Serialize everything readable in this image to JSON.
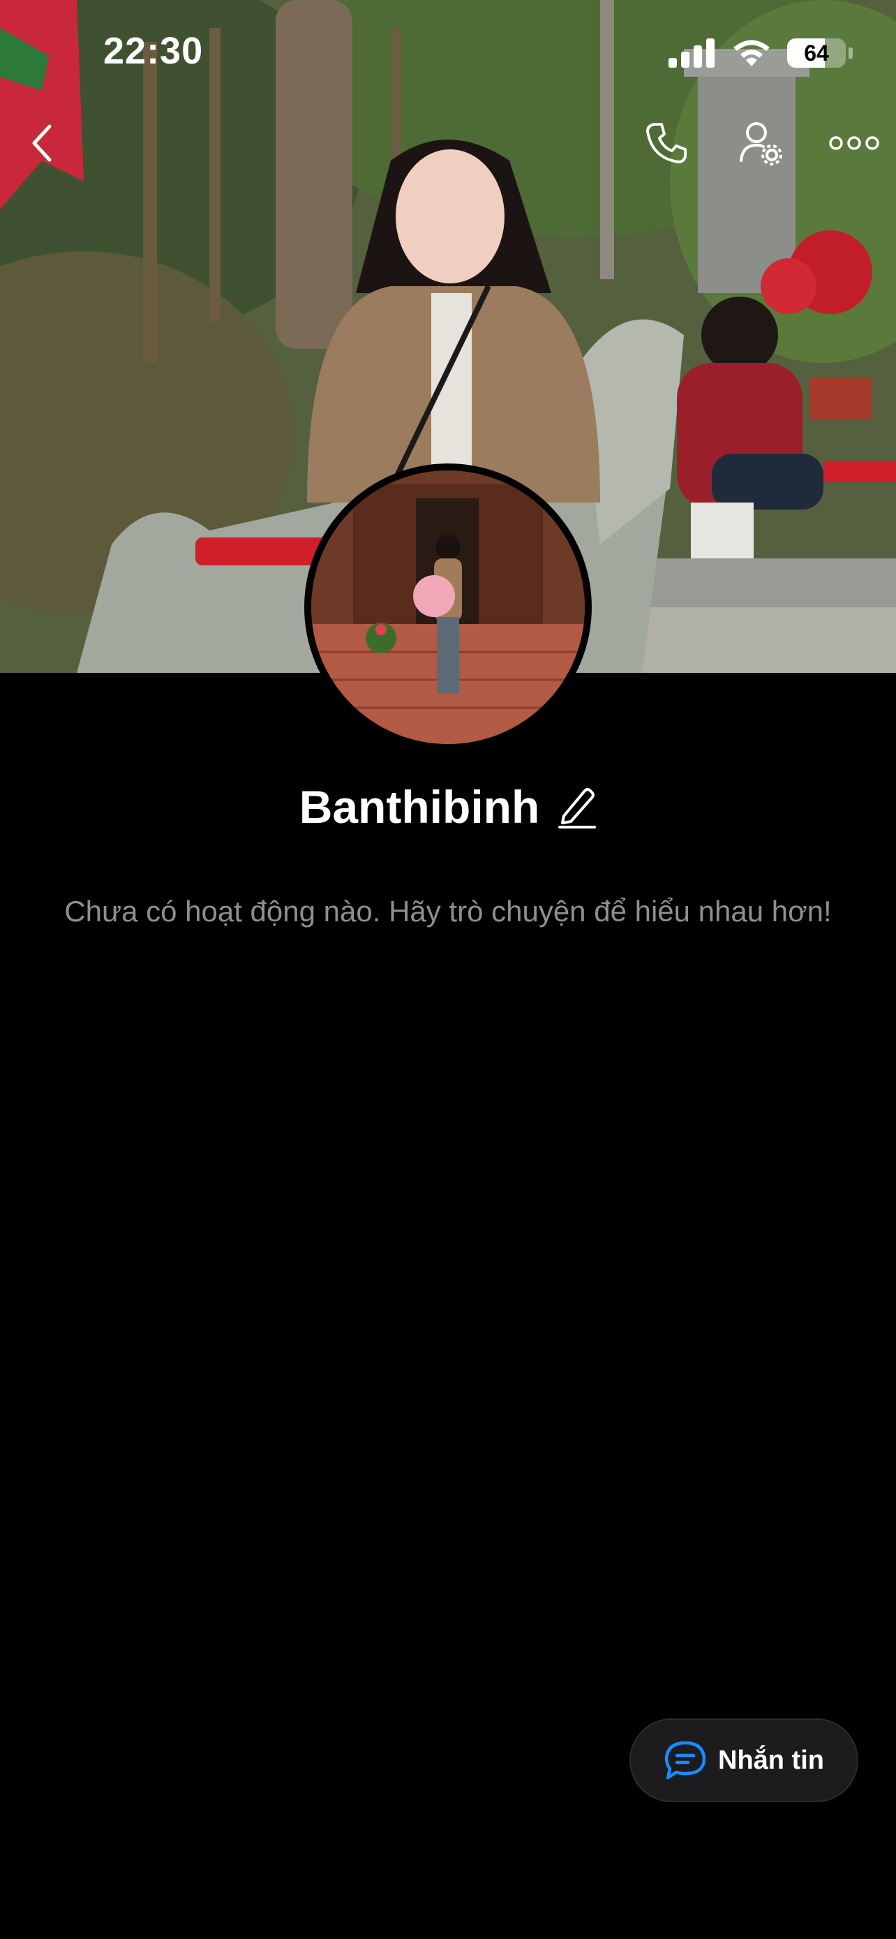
{
  "status_bar": {
    "time": "22:30",
    "battery_level": "64",
    "battery_fraction": 0.64,
    "icons": [
      "signal-icon",
      "wifi-icon",
      "battery-icon"
    ]
  },
  "nav": {
    "icons": [
      "back-chevron-icon",
      "phone-icon",
      "user-settings-icon",
      "more-dots-icon"
    ]
  },
  "profile": {
    "name": "Banthibinh",
    "empty_state": "Chưa có hoạt động nào. Hãy trò chuyện để hiểu nhau hơn!"
  },
  "actions": {
    "message_label": "Nhắn tin",
    "message_icon": "chat-bubble-icon"
  },
  "colors": {
    "background": "#000000",
    "accent_blue": "#1a8cff",
    "muted_text": "#8e8e93",
    "button_bg": "#1c1c1e"
  }
}
